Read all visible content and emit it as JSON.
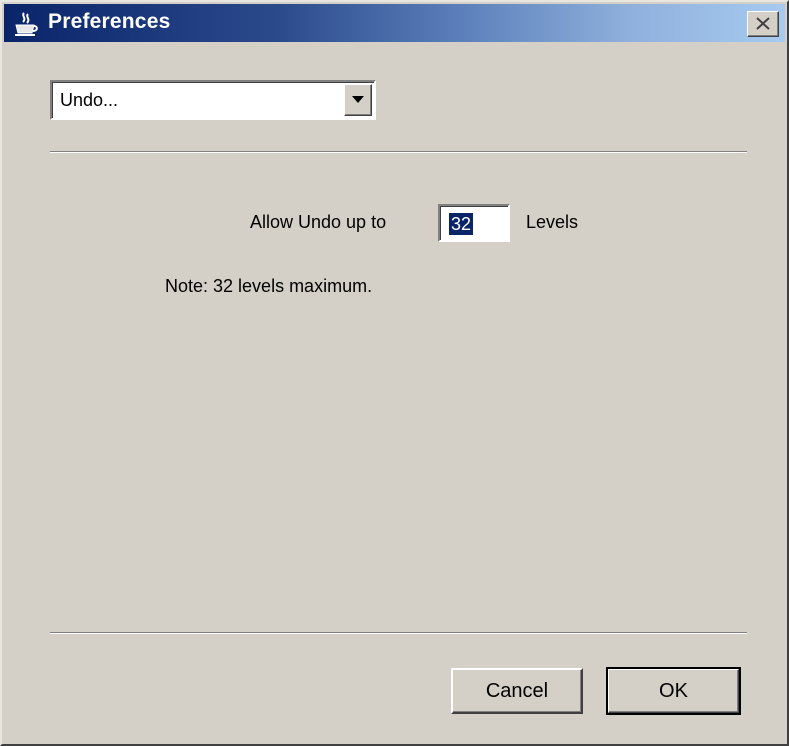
{
  "window": {
    "title": "Preferences",
    "icon": "java-cup-icon",
    "close_icon": "close-icon"
  },
  "category": {
    "selected": "Undo...",
    "arrow_icon": "chevron-down-icon"
  },
  "undo": {
    "label_before": "Allow Undo up to",
    "levels_value": "32",
    "label_after": "Levels",
    "note": "Note: 32 levels maximum."
  },
  "buttons": {
    "cancel_label": "Cancel",
    "ok_label": "OK"
  },
  "colors": {
    "title_start": "#0a246a",
    "title_end": "#a6caf0",
    "face": "#d4d0c8",
    "selection": "#0a246a"
  }
}
